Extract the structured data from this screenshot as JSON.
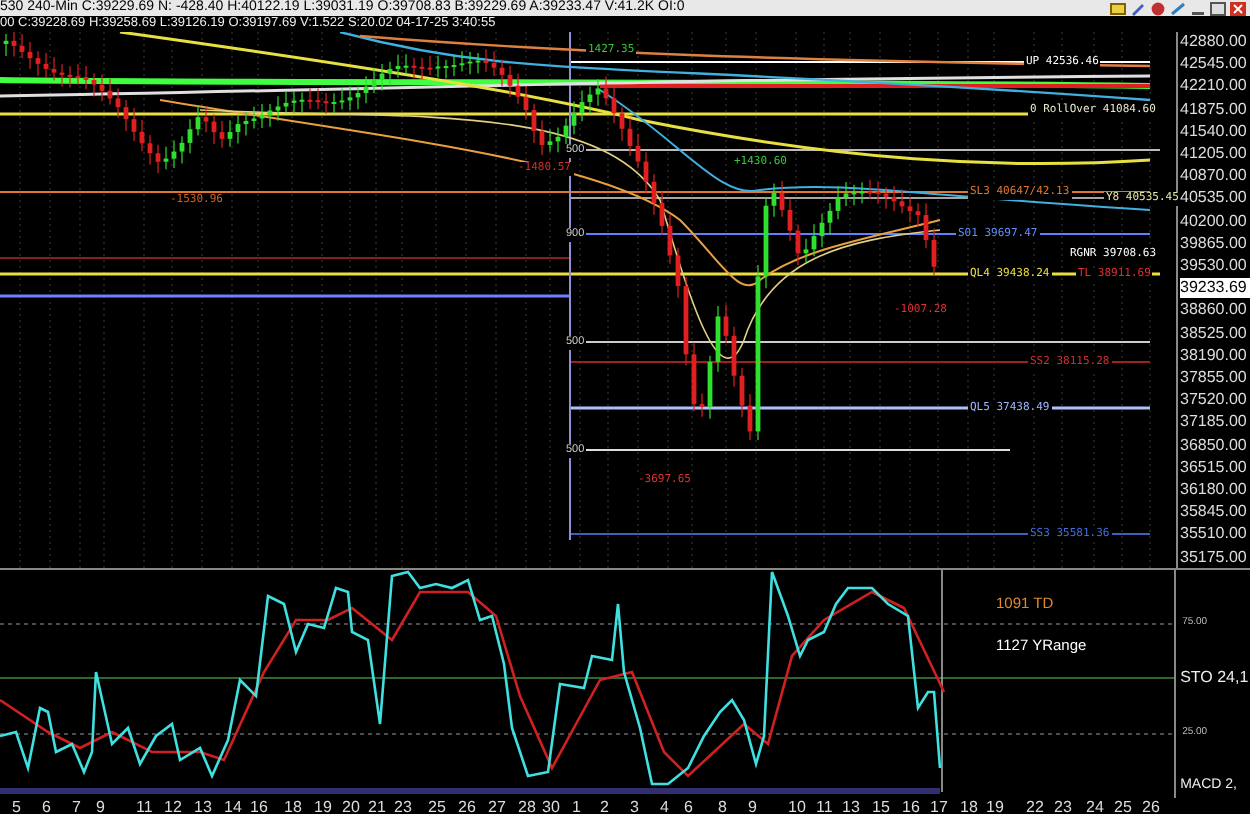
{
  "header": {
    "quote_line": "530 240-Min C:39229.69 N: -428.40 H:40122.19 L:39031.19 O:39708.83 B:39229.69 A:39233.47 V:41.2K OI:0",
    "bar_line": "00 C:39228.69 H:39258.69 L:39126.19 O:39197.69 V:1.522 S:20.02 04-17-25 3:40:55"
  },
  "price_chart": {
    "annotations": [
      {
        "text": "1427.35",
        "color": "#33cc33"
      },
      {
        "text": "UP 42536.46",
        "color": "#ffffff"
      },
      {
        "text": "0 RollOver 41084.60",
        "color": "#e8e8d0"
      },
      {
        "text": "-1530.96",
        "color": "#d06020"
      },
      {
        "text": "-1480.57",
        "color": "#d03030"
      },
      {
        "text": "+1430.60",
        "color": "#33cc33"
      },
      {
        "text": "SL3 40647/42.13",
        "color": "#e07830"
      },
      {
        "text": "Y8 40535.45",
        "color": "#e8e8a0"
      },
      {
        "text": "S01 39697.47",
        "color": "#6090ff"
      },
      {
        "text": "RGNR 39708.63",
        "color": "#ffffff"
      },
      {
        "text": "QL4 39438.24",
        "color": "#e8e040"
      },
      {
        "text": "TL 38911.69",
        "color": "#e03030"
      },
      {
        "text": "-1007.28",
        "color": "#e03030"
      },
      {
        "text": "SS2 38115.28",
        "color": "#d03030"
      },
      {
        "text": "QL5 37438.49",
        "color": "#a0b8ff"
      },
      {
        "text": "-3697.65",
        "color": "#e03030"
      },
      {
        "text": "SS3 35581.36",
        "color": "#4070e0"
      }
    ],
    "fib_labels": [
      "500",
      "900",
      "500",
      "500"
    ]
  },
  "price_axis": [
    {
      "label": "42880.00",
      "kind": "tick"
    },
    {
      "label": "42545.00",
      "kind": "tick"
    },
    {
      "label": "42210.00",
      "kind": "tick"
    },
    {
      "label": "41875.00",
      "kind": "tick"
    },
    {
      "label": "41540.00",
      "kind": "tick"
    },
    {
      "label": "41205.00",
      "kind": "tick"
    },
    {
      "label": "40870.00",
      "kind": "tick"
    },
    {
      "label": "40535.00",
      "kind": "tick"
    },
    {
      "label": "40200.00",
      "kind": "tick"
    },
    {
      "label": "39865.00",
      "kind": "tick"
    },
    {
      "label": "39530.00",
      "kind": "tick"
    },
    {
      "label": "39233.69",
      "kind": "current"
    },
    {
      "label": "38860.00",
      "kind": "tick"
    },
    {
      "label": "38525.00",
      "kind": "tick"
    },
    {
      "label": "38190.00",
      "kind": "tick"
    },
    {
      "label": "37855.00",
      "kind": "tick"
    },
    {
      "label": "37520.00",
      "kind": "tick"
    },
    {
      "label": "37185.00",
      "kind": "tick"
    },
    {
      "label": "36850.00",
      "kind": "tick"
    },
    {
      "label": "36515.00",
      "kind": "tick"
    },
    {
      "label": "36180.00",
      "kind": "tick"
    },
    {
      "label": "35845.00",
      "kind": "tick"
    },
    {
      "label": "35510.00",
      "kind": "tick"
    },
    {
      "label": "35175.00",
      "kind": "tick"
    }
  ],
  "oscillator": {
    "labels": [
      {
        "text": "1091 TD",
        "color": "#e08a2c"
      },
      {
        "text": "1127 YRange",
        "color": "#ffffff"
      }
    ],
    "levels": [
      "75.00",
      "25.00"
    ],
    "indicator": "STO  24,1",
    "macd": "MACD 2,"
  },
  "dates": [
    "5",
    "6",
    "7",
    "9",
    "11",
    "12",
    "13",
    "14",
    "16",
    "18",
    "19",
    "20",
    "21",
    "23",
    "25",
    "26",
    "27",
    "28",
    "30",
    "1",
    "2",
    "3",
    "4",
    "6",
    "8",
    "9",
    "10",
    "11",
    "13",
    "15",
    "16",
    "17",
    "18",
    "19",
    "22",
    "23",
    "24",
    "25",
    "26"
  ]
}
